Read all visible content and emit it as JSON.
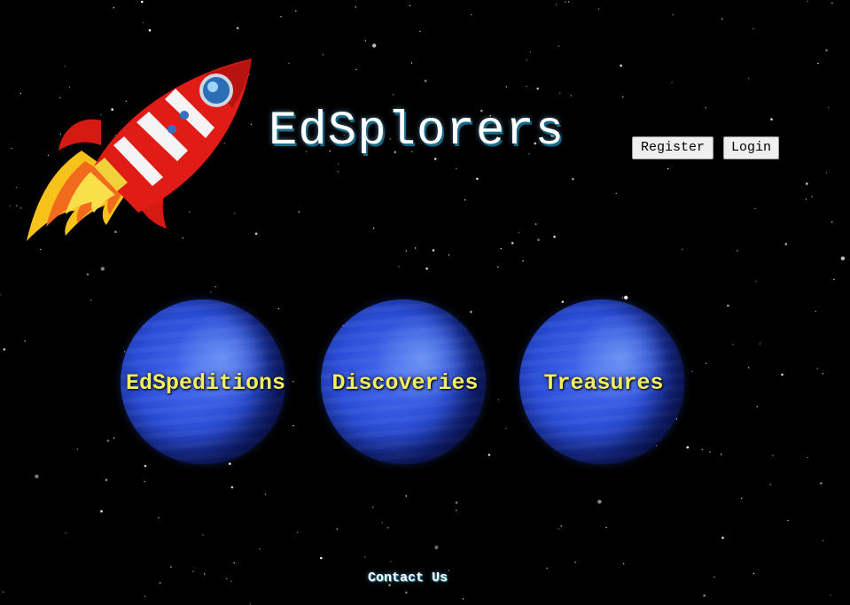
{
  "header": {
    "title": "EdSplorers",
    "register_label": "Register",
    "login_label": "Login"
  },
  "nav": {
    "items": [
      {
        "label": "EdSpeditions"
      },
      {
        "label": "Discoveries"
      },
      {
        "label": "Treasures"
      }
    ]
  },
  "footer": {
    "contact_label": "Contact Us"
  },
  "theme": {
    "background": "#000000",
    "planet_blue": "#2c4ed8",
    "label_yellow": "#f3ef5e",
    "title_shadow": "#1a6b8a"
  }
}
